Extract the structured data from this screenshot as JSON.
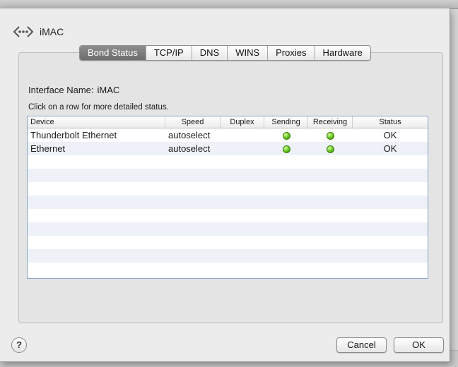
{
  "window": {
    "title": "iMAC"
  },
  "tabs": [
    {
      "label": "Bond Status",
      "active": true
    },
    {
      "label": "TCP/IP",
      "active": false
    },
    {
      "label": "DNS",
      "active": false
    },
    {
      "label": "WINS",
      "active": false
    },
    {
      "label": "Proxies",
      "active": false
    },
    {
      "label": "Hardware",
      "active": false
    }
  ],
  "interface": {
    "label": "Interface Name:",
    "value": "iMAC"
  },
  "hint": "Click on a row for more detailed status.",
  "table": {
    "columns": [
      "Device",
      "Speed",
      "Duplex",
      "Sending",
      "Receiving",
      "Status"
    ],
    "rows": [
      {
        "device": "Thunderbolt Ethernet",
        "speed": "autoselect",
        "duplex": "",
        "sending": "green",
        "receiving": "green",
        "status": "OK"
      },
      {
        "device": "Ethernet",
        "speed": "autoselect",
        "duplex": "",
        "sending": "green",
        "receiving": "green",
        "status": "OK"
      }
    ]
  },
  "buttons": {
    "help": "?",
    "cancel": "Cancel",
    "ok": "OK"
  },
  "colors": {
    "status_green": "#62c41a",
    "active_tab": "#7a7a7a",
    "table_border": "#8aa4c8"
  },
  "icons": {
    "header": "bond-network-icon"
  }
}
